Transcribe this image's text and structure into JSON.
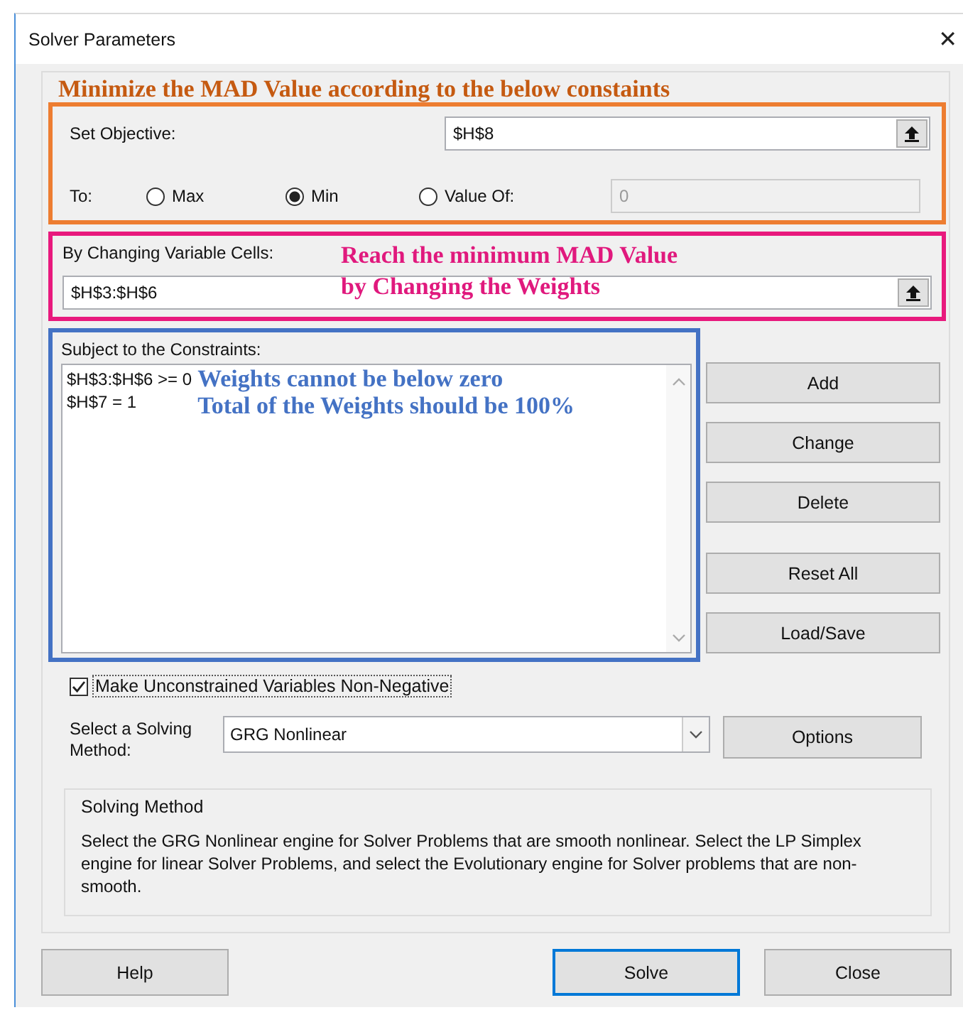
{
  "window": {
    "title": "Solver Parameters",
    "close": "✕"
  },
  "headline_note": "Minimize the MAD Value according to the below constaints",
  "objective": {
    "label": "Set Objective:",
    "value": "$H$8"
  },
  "to": {
    "label": "To:",
    "options": [
      {
        "label": "Max",
        "selected": false
      },
      {
        "label": "Min",
        "selected": true
      },
      {
        "label": "Value Of:",
        "selected": false
      }
    ],
    "value_of": {
      "value": "0",
      "disabled": true
    }
  },
  "variable_cells": {
    "label": "By Changing Variable Cells:",
    "value": "$H$3:$H$6",
    "note": [
      "Reach the minimum MAD Value",
      "by Changing the Weights"
    ]
  },
  "constraints": {
    "label": "Subject to the Constraints:",
    "items": [
      "$H$3:$H$6 >= 0",
      "$H$7 = 1"
    ],
    "notes": [
      "Weights cannot be below zero",
      "Total of the Weights should be 100%"
    ]
  },
  "side_buttons": [
    "Add",
    "Change",
    "Delete",
    "Reset All",
    "Load/Save"
  ],
  "nonnegative": {
    "label": "Make Unconstrained Variables Non-Negative",
    "checked": true
  },
  "method": {
    "label": "Select a Solving Method:",
    "value": "GRG Nonlinear",
    "options_button": "Options"
  },
  "description": {
    "title": "Solving Method",
    "text": "Select the GRG Nonlinear engine for Solver Problems that are smooth nonlinear. Select the LP Simplex engine for linear Solver Problems, and select the Evolutionary engine for Solver problems that are non-smooth."
  },
  "buttons": [
    {
      "label": "Help",
      "default": false
    },
    {
      "label": "Solve",
      "default": true
    },
    {
      "label": "Close",
      "default": false
    }
  ]
}
